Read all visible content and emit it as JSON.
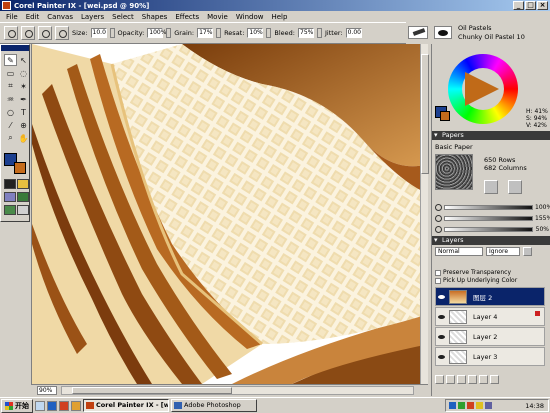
{
  "window": {
    "title": "Corel Painter IX - [wei.psd @ 90%]",
    "buttons": [
      "_",
      "□",
      "×"
    ]
  },
  "menu": [
    "File",
    "Edit",
    "Canvas",
    "Layers",
    "Select",
    "Shapes",
    "Effects",
    "Movie",
    "Window",
    "Help"
  ],
  "property_bar": {
    "size_label": "Size:",
    "size_value": "10.0",
    "opacity_label": "Opacity:",
    "opacity_value": "100%",
    "grain_label": "Grain:",
    "grain_value": "17%",
    "resat_label": "Resat:",
    "resat_value": "10%",
    "bleed_label": "Bleed:",
    "bleed_value": "75%",
    "jitter_label": "Jitter:",
    "jitter_value": "0.00"
  },
  "brush_selector": {
    "category": "Oil Pastels",
    "variant": "Chunky Oil Pastel 10"
  },
  "colors": {
    "main": "#1c3f8f",
    "secondary": "#c46b1c",
    "hsv": {
      "h": "H: 41%",
      "s": "S: 94%",
      "v": "V: 42%"
    }
  },
  "papers": {
    "title": "Papers",
    "paper_name": "Basic Paper",
    "rows": "650 Rows",
    "columns": "682 Columns",
    "sliders": [
      {
        "icon": "scale-icon",
        "value": "100%"
      },
      {
        "icon": "contrast-icon",
        "value": "155%"
      },
      {
        "icon": "brightness-icon",
        "value": "50%"
      }
    ]
  },
  "layers": {
    "title": "Layers",
    "composite_method": "Normal",
    "composite_depth": "Ignore",
    "preserve_transparency": "Preserve Transparency",
    "pick_up_color": "Pick Up Underlying Color",
    "items": [
      {
        "name": "图层 2",
        "selected": true
      },
      {
        "name": "Layer 4",
        "selected": false
      },
      {
        "name": "Layer 2",
        "selected": false
      },
      {
        "name": "Layer 3",
        "selected": false
      }
    ]
  },
  "status": {
    "zoom": "90%"
  },
  "taskbar": {
    "start_label": "开始",
    "tasks": [
      {
        "label": "Corel Painter IX - [wei...",
        "active": true
      },
      {
        "label": "Adobe Photoshop",
        "active": false
      }
    ],
    "clock": "14:38"
  }
}
